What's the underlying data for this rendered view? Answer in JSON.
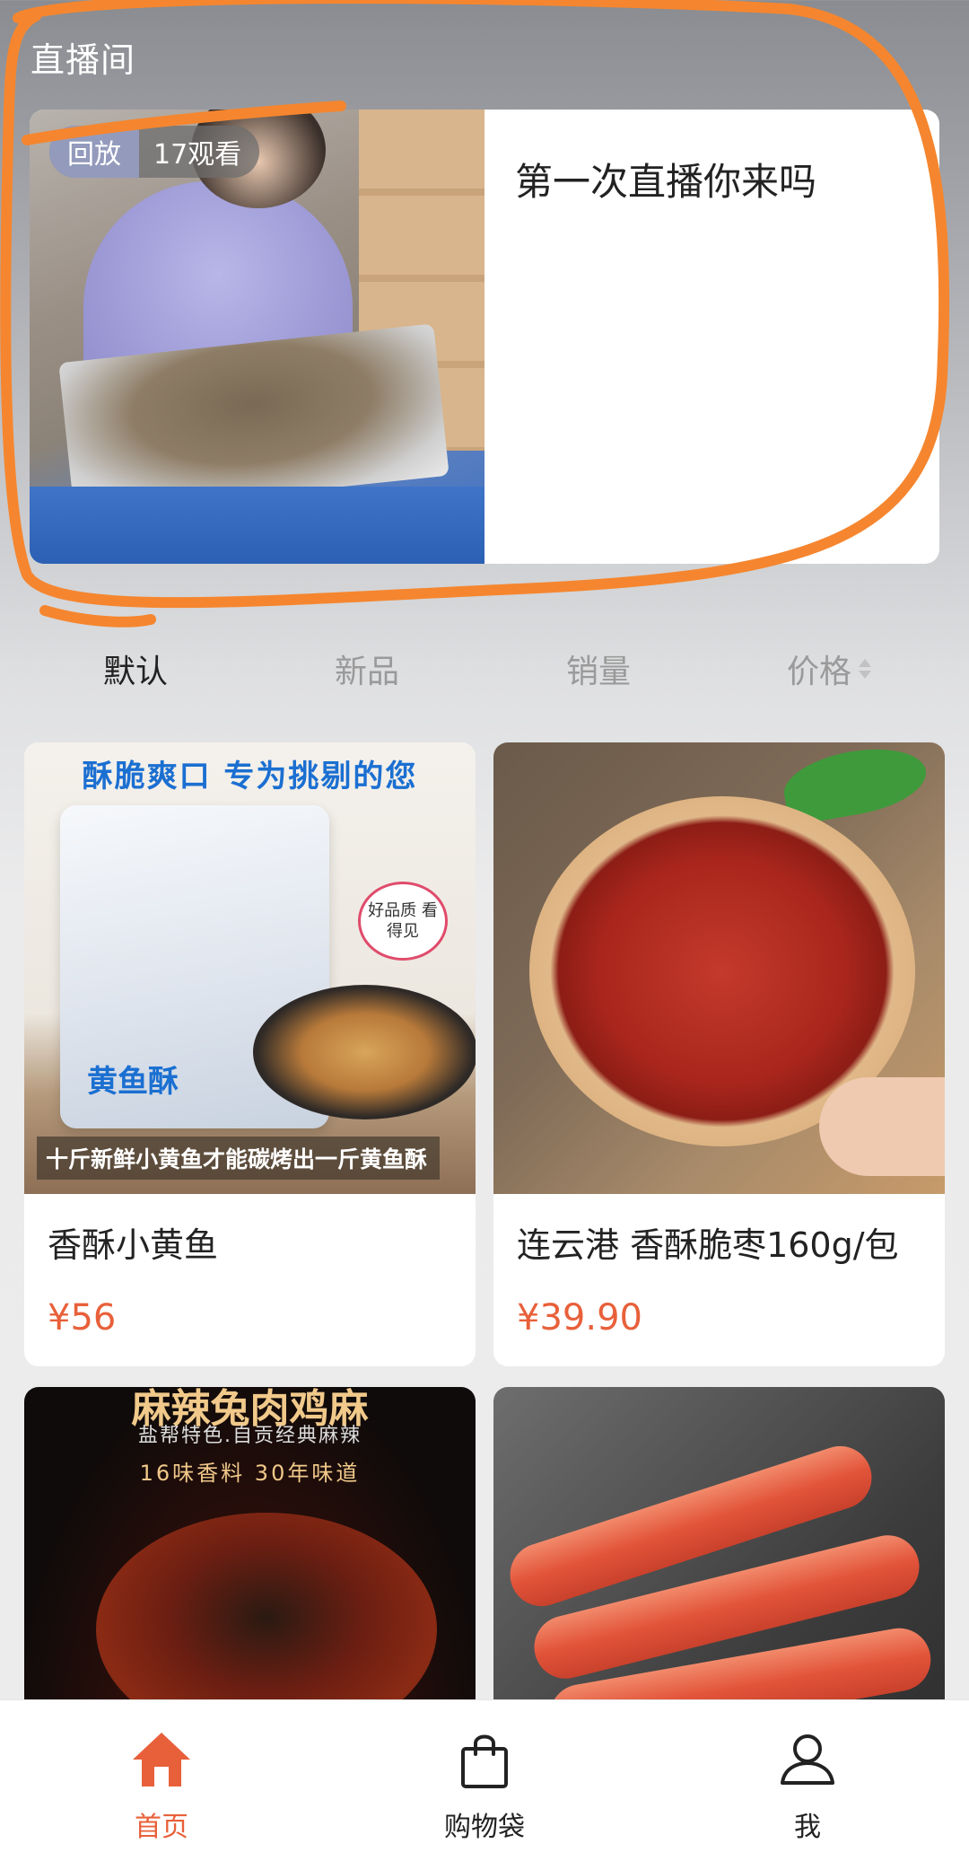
{
  "live_section": {
    "title": "直播间",
    "card": {
      "replay_badge": "回放",
      "viewers": "17观看",
      "name": "第一次直播你来吗"
    }
  },
  "sort_tabs": [
    {
      "label": "默认",
      "active": true
    },
    {
      "label": "新品",
      "active": false
    },
    {
      "label": "销量",
      "active": false
    },
    {
      "label": "价格",
      "active": false
    }
  ],
  "products": [
    {
      "name": "香酥小黄鱼",
      "price": "¥56",
      "image_texts": {
        "banner": "酥脆爽口  专为挑剔的您",
        "bag_label": "黄鱼酥",
        "bubble": "好品质 看得见",
        "caption": "十斤新鲜小黄鱼才能碳烤出一斤黄鱼酥"
      }
    },
    {
      "name": "连云港 香酥脆枣160g/包",
      "price": "¥39.90"
    },
    {
      "name": "",
      "price": "",
      "image_texts": {
        "title": "麻辣兔肉鸡麻",
        "sub": "盐帮特色.自贡经典麻辣",
        "sub2": "16味香料  30年味道"
      }
    },
    {
      "name": "",
      "price": ""
    }
  ],
  "bottom_nav": [
    {
      "label": "首页",
      "icon": "home-icon",
      "active": true
    },
    {
      "label": "购物袋",
      "icon": "shopping-bag-icon",
      "active": false
    },
    {
      "label": "我",
      "icon": "user-icon",
      "active": false
    }
  ],
  "colors": {
    "accent": "#e8603a",
    "annotation": "#f5862f"
  }
}
